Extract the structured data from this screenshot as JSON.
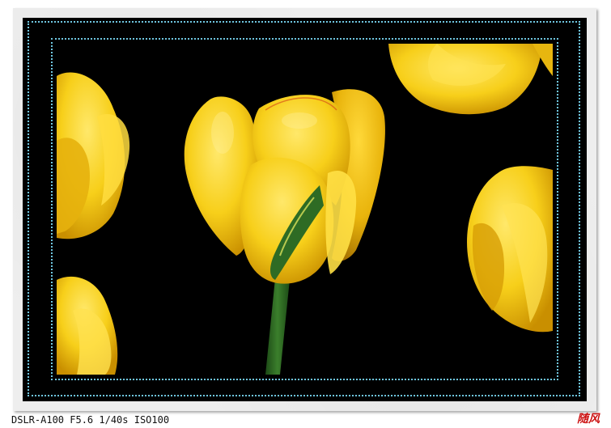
{
  "photo": {
    "subject": "yellow tulips on black background",
    "caption": "DSLR-A100 F5.6 1/40s ISO100",
    "signature": "随风"
  },
  "colors": {
    "background": "#000000",
    "frame_line": "#6fc6e0",
    "mat": "#eeeeee",
    "tulip_yellow": "#f7cf1a",
    "tulip_shadow": "#c98f00",
    "stem_green": "#2c6a22",
    "signature_red": "#cc1111"
  }
}
